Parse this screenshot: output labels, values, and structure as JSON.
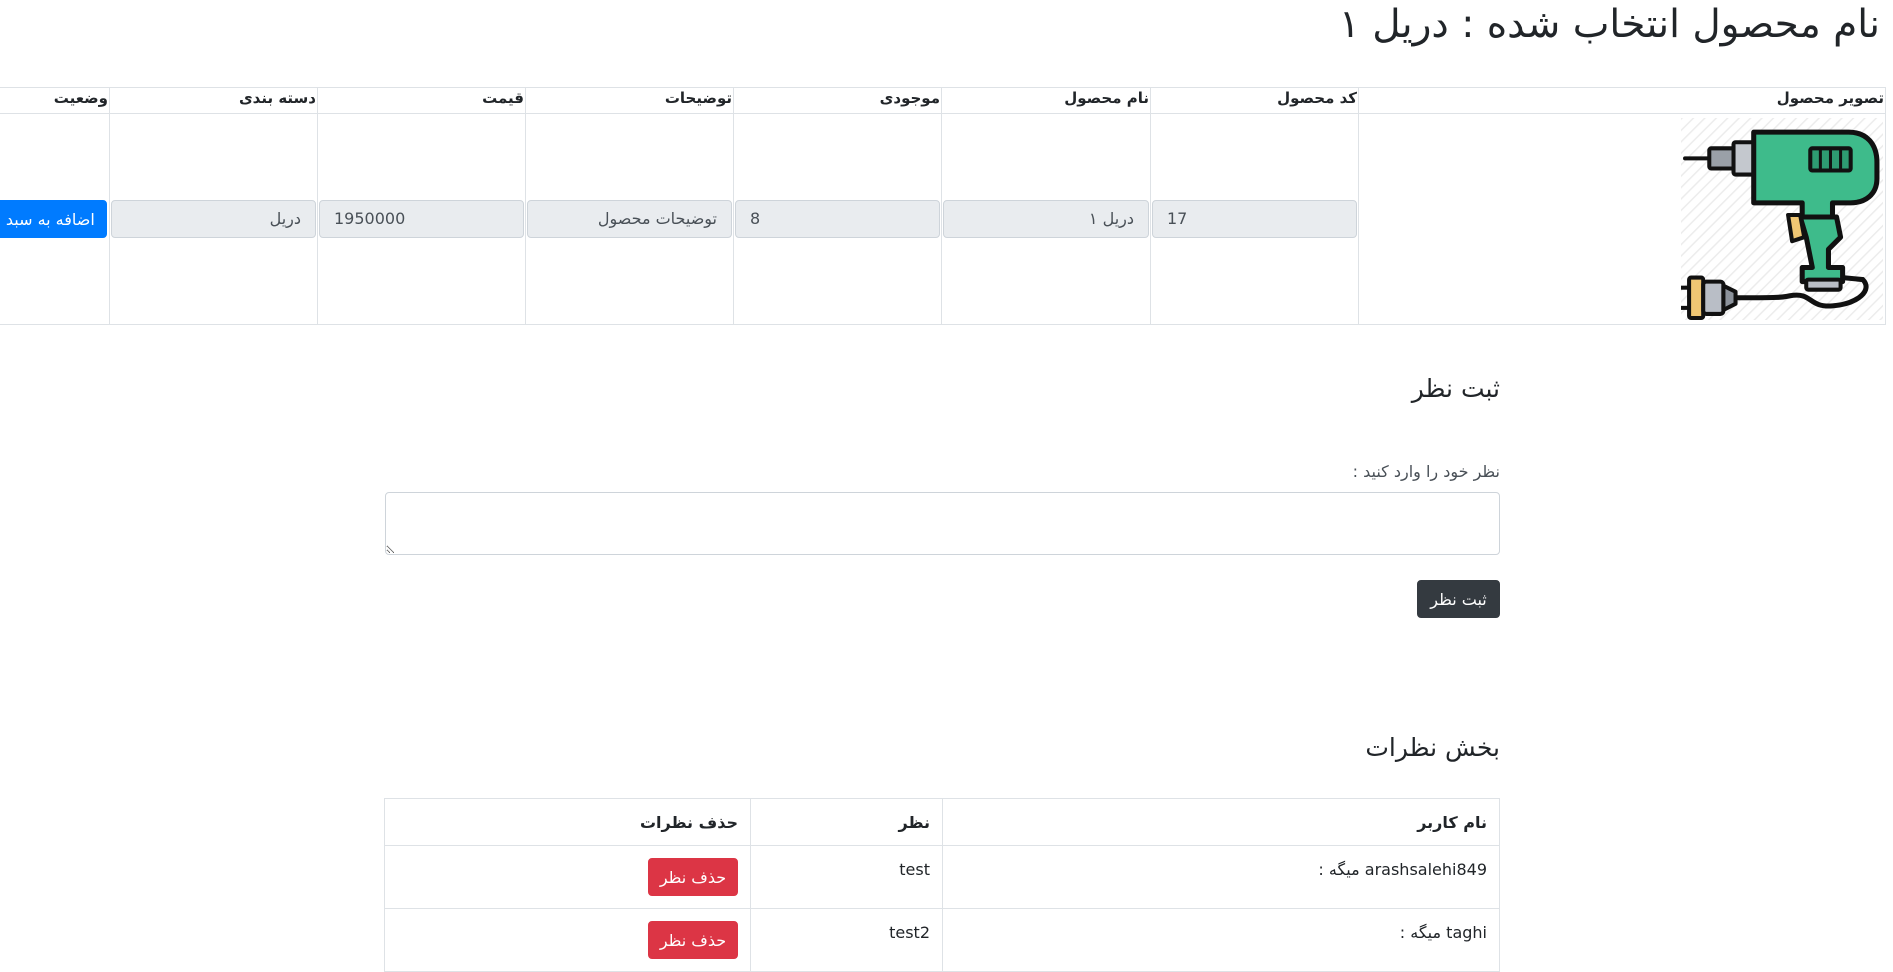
{
  "page": {
    "title": "نام محصول انتخاب شده : دریل ۱"
  },
  "product_table": {
    "headers": {
      "image": "تصویر محصول",
      "code": "کد محصول",
      "name": "نام محصول",
      "stock": "موجودی",
      "description": "توضیحات",
      "price": "قیمت",
      "category": "دسته بندی",
      "status": "وضعیت"
    },
    "row": {
      "code": "17",
      "name": "دریل ۱",
      "stock": "8",
      "description": "توضیحات محصول",
      "price": "1950000",
      "category": "دریل",
      "add_to_cart_label": "اضافه به سبد خرید"
    },
    "image_icon": "drill-icon"
  },
  "comment_form": {
    "heading": "ثبت نظر",
    "label": "نظر خود را وارد کنید :",
    "textarea_value": "",
    "submit_label": "ثبت نظر"
  },
  "comments": {
    "heading": "بخش نظرات",
    "columns": {
      "user": "نام کاربر",
      "comment": "نظر",
      "delete": "حذف نظرات"
    },
    "rows": [
      {
        "user": "arashsalehi849",
        "says": "میگه :",
        "comment": "test",
        "delete_label": "حذف نظر"
      },
      {
        "user": "taghi",
        "says": "میگه :",
        "comment": "test2",
        "delete_label": "حذف نظر"
      }
    ]
  },
  "colors": {
    "primary": "#007bff",
    "dark": "#343a40",
    "danger": "#dc3545",
    "drill_green": "#3ebb8b",
    "readonly_bg": "#e9ecef",
    "border": "#dee2e6"
  }
}
